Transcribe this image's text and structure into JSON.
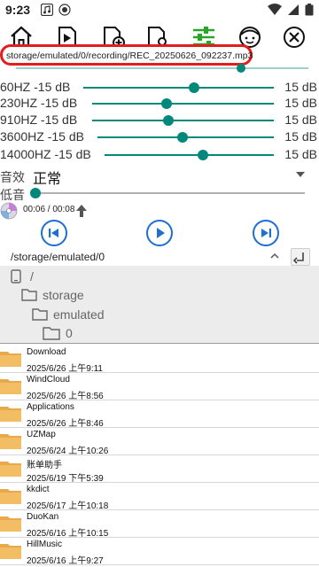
{
  "status": {
    "time": "9:23"
  },
  "toolbar": {
    "icons": [
      "home-icon",
      "play-file-icon",
      "new-file-icon",
      "search-file-icon",
      "equalizer-icon",
      "face-icon",
      "close-icon"
    ]
  },
  "recording": {
    "path": "storage/emulated/0/recording/REC_20250626_092237.mp3",
    "progress": 0.77
  },
  "equalizer": {
    "bands": [
      {
        "label": "60HZ -15 dB",
        "max": "15 dB",
        "level": 0.58
      },
      {
        "label": "230HZ -15 dB",
        "max": "15 dB",
        "level": 0.41
      },
      {
        "label": "910HZ -15 dB",
        "max": "15 dB",
        "level": 0.42
      },
      {
        "label": "3600HZ -15 dB",
        "max": "15 dB",
        "level": 0.48
      },
      {
        "label": "14000HZ -15 dB",
        "max": "15 dB",
        "level": 0.58
      }
    ]
  },
  "effect": {
    "label": "音效",
    "value": "正常"
  },
  "bass": {
    "label": "低音",
    "level": 0.0
  },
  "playback": {
    "time": "00:06 / 00:08"
  },
  "browser": {
    "current_path": "/storage/emulated/0",
    "tree": [
      {
        "label": "/"
      },
      {
        "label": "storage"
      },
      {
        "label": "emulated"
      },
      {
        "label": "0"
      }
    ],
    "files": [
      {
        "name": "Download",
        "date": "2025/6/26 上午9:11"
      },
      {
        "name": "WindCloud",
        "date": "2025/6/26 上午8:56"
      },
      {
        "name": "Applications",
        "date": "2025/6/26 上午8:46"
      },
      {
        "name": "UZMap",
        "date": "2025/6/24 上午10:26"
      },
      {
        "name": "账单助手",
        "date": "2025/6/19 下午5:39"
      },
      {
        "name": "kkdict",
        "date": "2025/6/17 上午10:18"
      },
      {
        "name": "DuoKan",
        "date": "2025/6/16 上午10:15"
      },
      {
        "name": "HillMusic",
        "date": "2025/6/16 上午9:27"
      }
    ]
  },
  "colors": {
    "accent": "#00897b",
    "highlight_ring": "#e31c1c",
    "control_blue": "#1e6fd1",
    "folder": "#e8a94c"
  }
}
